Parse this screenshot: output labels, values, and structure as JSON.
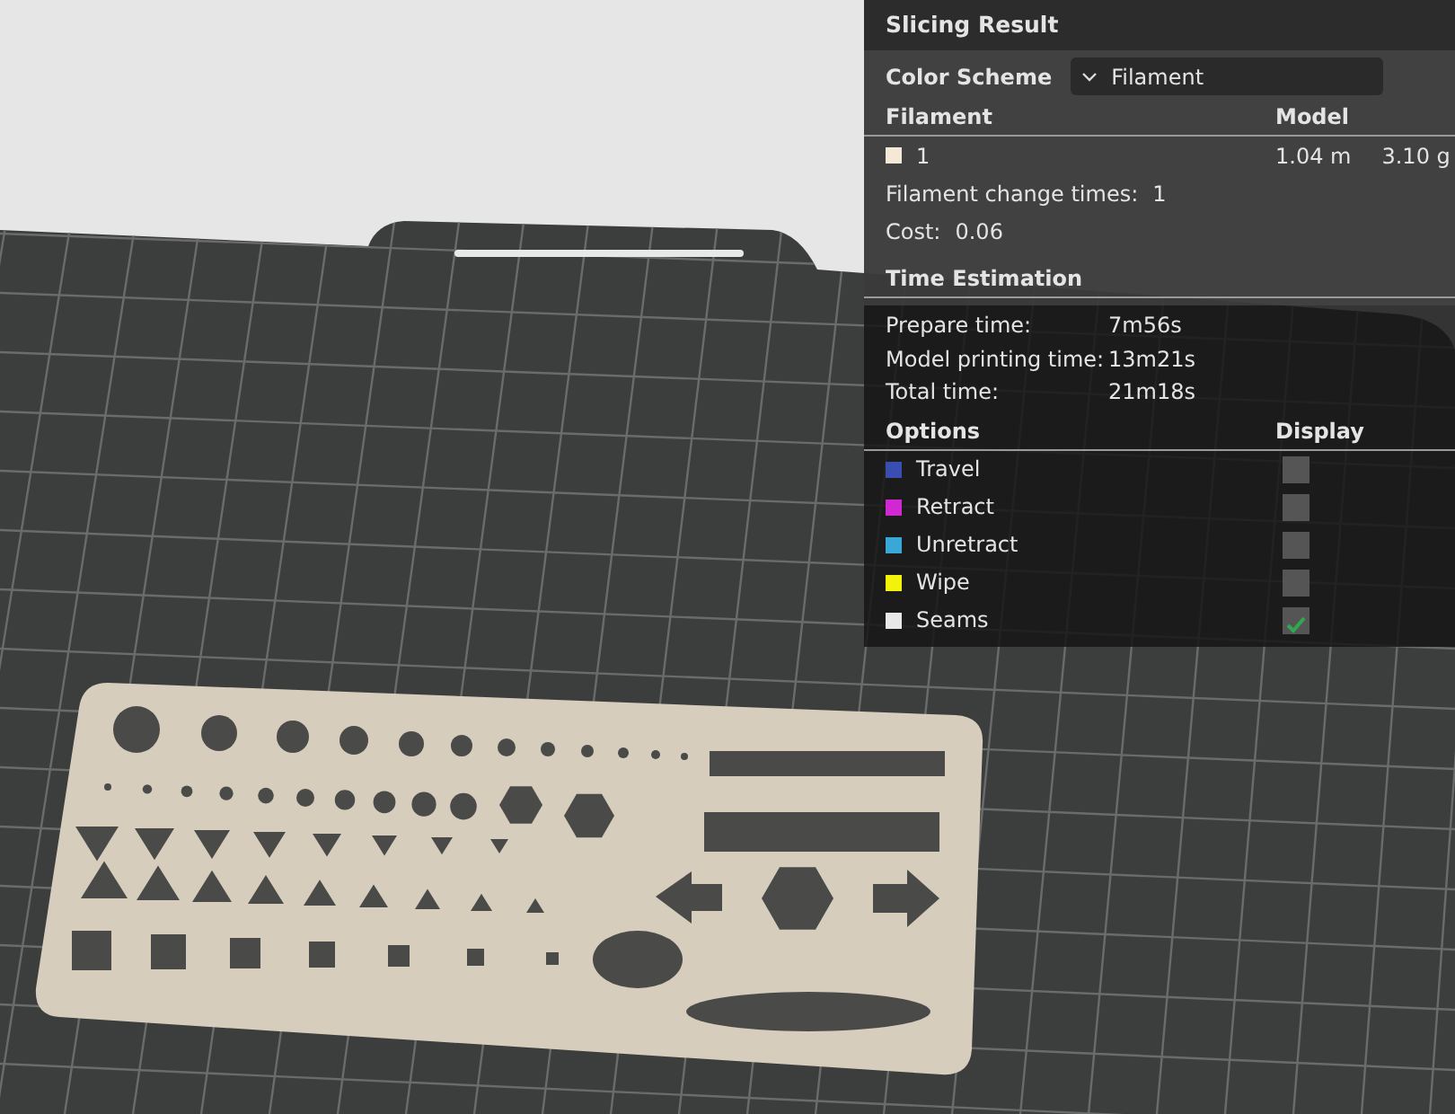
{
  "panel": {
    "title": "Slicing Result",
    "color_scheme": {
      "label": "Color Scheme",
      "value": "Filament"
    },
    "filament_table": {
      "columns": [
        "Filament",
        "Model"
      ],
      "rows": [
        {
          "name": "1",
          "color": "#f3e9d6",
          "length": "1.04 m",
          "weight": "3.10 g"
        }
      ]
    },
    "filament_change": {
      "label": "Filament change times:",
      "value": "1"
    },
    "cost": {
      "label": "Cost:",
      "value": "0.06"
    },
    "time_estimation": {
      "title": "Time Estimation",
      "rows": [
        {
          "label": "Prepare time:",
          "value": "7m56s"
        },
        {
          "label": "Model printing time:",
          "value": "13m21s"
        },
        {
          "label": "Total time:",
          "value": "21m18s"
        }
      ]
    },
    "options": {
      "columns": [
        "Options",
        "Display"
      ],
      "rows": [
        {
          "name": "Travel",
          "color": "#3a4db0",
          "checked": false
        },
        {
          "name": "Retract",
          "color": "#d129d1",
          "checked": false
        },
        {
          "name": "Unretract",
          "color": "#3aa8d6",
          "checked": false
        },
        {
          "name": "Wipe",
          "color": "#f2f20a",
          "checked": false
        },
        {
          "name": "Seams",
          "color": "#e8e8e8",
          "checked": true
        }
      ]
    }
  }
}
